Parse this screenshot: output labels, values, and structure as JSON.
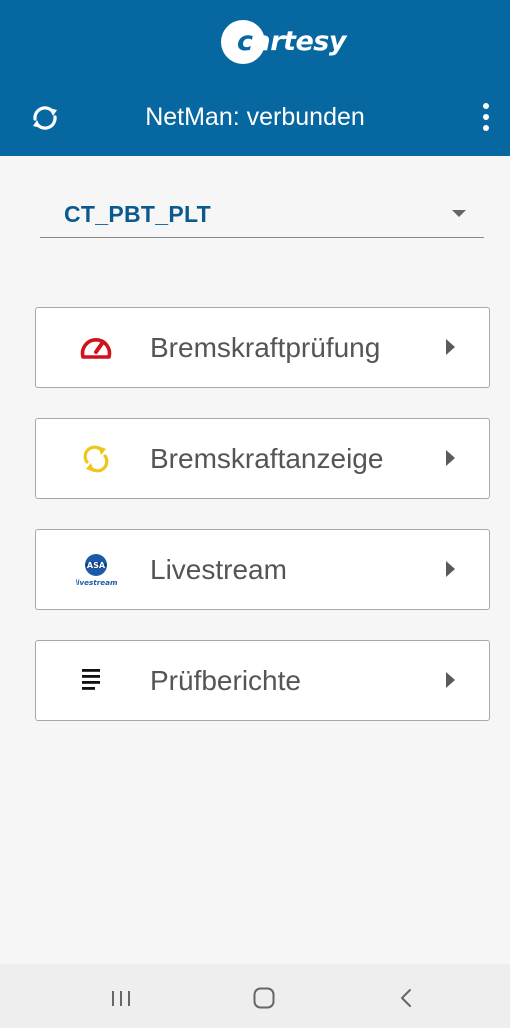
{
  "app": {
    "logo_text": "artesy",
    "logo_initial": "c",
    "title": "NetMan: verbunden"
  },
  "device_selector": {
    "selected": "CT_PBT_PLT"
  },
  "menu": [
    {
      "label": "Bremskraftprüfung",
      "icon": "speedometer-icon",
      "color": "#d0121b"
    },
    {
      "label": "Bremskraftanzeige",
      "icon": "refresh-icon",
      "color": "#f0c419"
    },
    {
      "label": "Livestream",
      "icon": "livestream-logo-icon",
      "icon_text": "livestream",
      "icon_badge": "ASA",
      "color": "#1c5aa8"
    },
    {
      "label": "Prüfberichte",
      "icon": "list-lines-icon",
      "color": "#111111"
    }
  ],
  "colors": {
    "appbar": "#0667a1",
    "accent_text": "#0b5a8f"
  }
}
